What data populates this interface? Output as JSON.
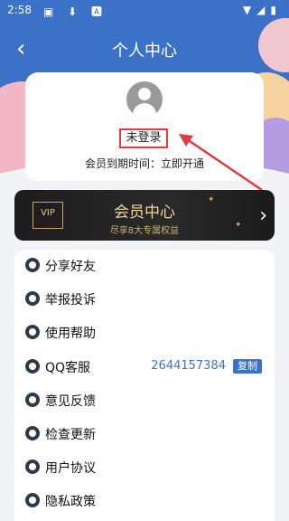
{
  "status_bar": {
    "time": "2:58",
    "left_icons": "▣ ⬇ 🅰"
  },
  "header": {
    "title": "个人中心"
  },
  "profile": {
    "login_text": "未登录",
    "expire_text": "会员到期时间：立即开通"
  },
  "vip": {
    "badge": "VIP",
    "title": "会员中心",
    "subtitle": "尽享8大专属权益"
  },
  "menu": [
    {
      "label": "分享好友"
    },
    {
      "label": "举报投诉"
    },
    {
      "label": "使用帮助"
    },
    {
      "label": "QQ客服",
      "value": "2644157384",
      "action": "复制"
    },
    {
      "label": "意见反馈"
    },
    {
      "label": "检查更新"
    },
    {
      "label": "用户协议"
    },
    {
      "label": "隐私政策"
    }
  ],
  "colors": {
    "accent": "#3b72c8",
    "annotation": "#e23b3b",
    "vip_gold": "#f1d59b"
  }
}
